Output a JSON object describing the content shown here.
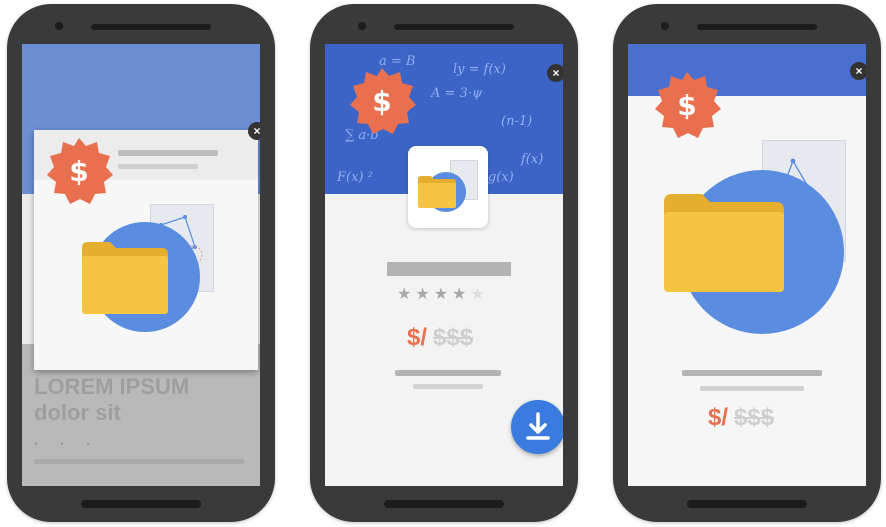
{
  "colors": {
    "phone_frame": "#3a3a3a",
    "blue_header": "#3c64c7",
    "badge_orange": "#e8704f",
    "folder_yellow": "#f5c542",
    "circle_blue": "#5a8de0",
    "download_blue": "#3a7be0"
  },
  "phones": [
    {
      "background_text": {
        "line1": "LOREM IPSUM",
        "line2": "dolor sit"
      },
      "badge_glyph": "$",
      "close_glyph": "×",
      "icons": [
        "price-tag-badge-icon",
        "folder-icon",
        "close-icon"
      ]
    },
    {
      "badge_glyph": "$",
      "close_glyph": "×",
      "formulas": [
        "a = B",
        "ly = f(x)",
        "A = 3·ψ",
        "∑ a·b",
        "f(x)",
        "(n-1)",
        "F(x) ²",
        "α·g(x)"
      ],
      "rating": {
        "filled": 4,
        "total": 5
      },
      "price_new": "$/",
      "price_old": "$$$",
      "icons": [
        "price-tag-badge-icon",
        "folder-icon",
        "download-icon",
        "close-icon",
        "star-icon"
      ]
    },
    {
      "badge_glyph": "$",
      "close_glyph": "×",
      "price_new": "$/",
      "price_old": "$$$",
      "icons": [
        "price-tag-badge-icon",
        "folder-icon",
        "close-icon"
      ]
    }
  ]
}
